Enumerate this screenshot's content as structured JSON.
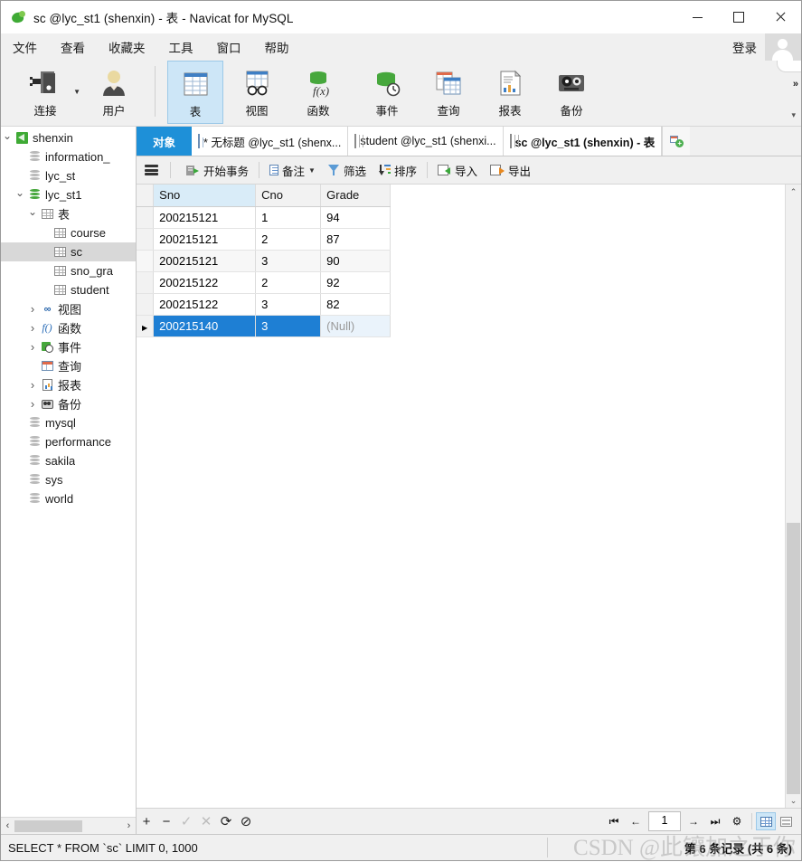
{
  "window": {
    "title": "sc @lyc_st1 (shenxin) - 表 - Navicat for MySQL",
    "app_icon": "navicat-logo-icon",
    "minimize": "−",
    "maximize": "□",
    "close": "✕"
  },
  "menubar": {
    "items": [
      {
        "label": "文件",
        "name": "menu-file"
      },
      {
        "label": "查看",
        "name": "menu-view"
      },
      {
        "label": "收藏夹",
        "name": "menu-favorites"
      },
      {
        "label": "工具",
        "name": "menu-tools"
      },
      {
        "label": "窗口",
        "name": "menu-window"
      },
      {
        "label": "帮助",
        "name": "menu-help"
      }
    ],
    "login_label": "登录"
  },
  "ribbon": {
    "items": [
      {
        "label": "连接",
        "icon": "connection-icon",
        "active": false,
        "has_caret": true
      },
      {
        "label": "用户",
        "icon": "user-icon",
        "active": false,
        "has_caret": false
      },
      {
        "label": "表",
        "icon": "table-icon",
        "active": true,
        "has_caret": false
      },
      {
        "label": "视图",
        "icon": "view-icon",
        "active": false,
        "has_caret": false
      },
      {
        "label": "函数",
        "icon": "function-icon",
        "active": false,
        "has_caret": false
      },
      {
        "label": "事件",
        "icon": "event-icon",
        "active": false,
        "has_caret": false
      },
      {
        "label": "查询",
        "icon": "query-icon",
        "active": false,
        "has_caret": false
      },
      {
        "label": "报表",
        "icon": "report-icon",
        "active": false,
        "has_caret": false
      },
      {
        "label": "备份",
        "icon": "backup-icon",
        "active": false,
        "has_caret": false
      }
    ],
    "expand_label": "»",
    "more_label": "▾"
  },
  "sidebar": {
    "tree": [
      {
        "label": "shenxin",
        "indent": 0,
        "arrow": "open",
        "icon": "connection-icon",
        "selected": false
      },
      {
        "label": "information_",
        "indent": 1,
        "arrow": "none",
        "icon": "database-gray-icon",
        "selected": false
      },
      {
        "label": "lyc_st",
        "indent": 1,
        "arrow": "none",
        "icon": "database-gray-icon",
        "selected": false
      },
      {
        "label": "lyc_st1",
        "indent": 1,
        "arrow": "open",
        "icon": "database-green-icon",
        "selected": false
      },
      {
        "label": "表",
        "indent": 2,
        "arrow": "open",
        "icon": "table-folder-icon",
        "selected": false
      },
      {
        "label": "course",
        "indent": 3,
        "arrow": "none",
        "icon": "table-icon",
        "selected": false
      },
      {
        "label": "sc",
        "indent": 3,
        "arrow": "none",
        "icon": "table-icon",
        "selected": true
      },
      {
        "label": "sno_gra",
        "indent": 3,
        "arrow": "none",
        "icon": "table-icon",
        "selected": false
      },
      {
        "label": "student",
        "indent": 3,
        "arrow": "none",
        "icon": "table-icon",
        "selected": false
      },
      {
        "label": "视图",
        "indent": 2,
        "arrow": "closed",
        "icon": "view-icon",
        "selected": false
      },
      {
        "label": "函数",
        "indent": 2,
        "arrow": "closed",
        "icon": "function-icon",
        "selected": false
      },
      {
        "label": "事件",
        "indent": 2,
        "arrow": "closed",
        "icon": "event-icon",
        "selected": false
      },
      {
        "label": "查询",
        "indent": 2,
        "arrow": "none",
        "icon": "query-icon",
        "selected": false
      },
      {
        "label": "报表",
        "indent": 2,
        "arrow": "closed",
        "icon": "report-icon",
        "selected": false
      },
      {
        "label": "备份",
        "indent": 2,
        "arrow": "closed",
        "icon": "backup-icon",
        "selected": false
      },
      {
        "label": "mysql",
        "indent": 1,
        "arrow": "none",
        "icon": "database-gray-icon",
        "selected": false
      },
      {
        "label": "performance",
        "indent": 1,
        "arrow": "none",
        "icon": "database-gray-icon",
        "selected": false
      },
      {
        "label": "sakila",
        "indent": 1,
        "arrow": "none",
        "icon": "database-gray-icon",
        "selected": false
      },
      {
        "label": "sys",
        "indent": 1,
        "arrow": "none",
        "icon": "database-gray-icon",
        "selected": false
      },
      {
        "label": "world",
        "indent": 1,
        "arrow": "none",
        "icon": "database-gray-icon",
        "selected": false
      }
    ],
    "scroll_left": "‹",
    "scroll_right": "›"
  },
  "tabs": [
    {
      "label": "对象",
      "type": "object",
      "active": false
    },
    {
      "label": "* 无标题 @lyc_st1 (shenx...",
      "type": "query",
      "active": false
    },
    {
      "label": "student @lyc_st1 (shenxi...",
      "type": "table",
      "active": false
    },
    {
      "label": "sc @lyc_st1 (shenxin) - 表",
      "type": "table",
      "active": true
    }
  ],
  "grid_toolbar": {
    "menu_icon": "hamburger-icon",
    "buttons": [
      {
        "label": "开始事务",
        "icon": "begin-transaction-icon",
        "caret": false
      },
      {
        "label": "备注",
        "icon": "note-icon",
        "caret": true
      },
      {
        "label": "筛选",
        "icon": "filter-icon",
        "caret": false
      },
      {
        "label": "排序",
        "icon": "sort-icon",
        "caret": false
      },
      {
        "label": "导入",
        "icon": "import-icon",
        "caret": false
      },
      {
        "label": "导出",
        "icon": "export-icon",
        "caret": false
      }
    ]
  },
  "grid": {
    "columns": [
      "Sno",
      "Cno",
      "Grade"
    ],
    "sorted_column": "Sno",
    "null_label": "(Null)",
    "rows": [
      {
        "Sno": "200215121",
        "Cno": "1",
        "Grade": "94",
        "selected": false,
        "null_grade": false
      },
      {
        "Sno": "200215121",
        "Cno": "2",
        "Grade": "87",
        "selected": false,
        "null_grade": false
      },
      {
        "Sno": "200215121",
        "Cno": "3",
        "Grade": "90",
        "selected": false,
        "null_grade": false
      },
      {
        "Sno": "200215122",
        "Cno": "2",
        "Grade": "92",
        "selected": false,
        "null_grade": false
      },
      {
        "Sno": "200215122",
        "Cno": "3",
        "Grade": "82",
        "selected": false,
        "null_grade": false
      },
      {
        "Sno": "200215140",
        "Cno": "3",
        "Grade": "(Null)",
        "selected": true,
        "null_grade": true
      }
    ]
  },
  "bottom_toolbar": {
    "buttons": [
      {
        "label": "+",
        "name": "add-record-button",
        "disabled": false
      },
      {
        "label": "−",
        "name": "delete-record-button",
        "disabled": false
      },
      {
        "label": "✓",
        "name": "apply-change-button",
        "disabled": true
      },
      {
        "label": "✕",
        "name": "cancel-change-button",
        "disabled": true
      },
      {
        "label": "⟳",
        "name": "refresh-button",
        "disabled": false
      },
      {
        "label": "⊘",
        "name": "stop-button",
        "disabled": false
      }
    ],
    "nav": {
      "first": "⏮",
      "prev": "←",
      "page": "1",
      "next": "→",
      "last": "⏭",
      "settings": "⚙"
    },
    "view_grid": "grid-view-icon",
    "view_form": "form-view-icon"
  },
  "statusbar": {
    "sql": "SELECT * FROM `sc` LIMIT 0, 1000",
    "record_info": "第 6 条记录 (共 6 条)",
    "watermark": "CSDN @此镶加之于你"
  },
  "colors": {
    "accent_blue": "#1e90d8",
    "selection_blue": "#1e7fd4",
    "ribbon_active": "#cde6f7",
    "green": "#3faa35"
  }
}
